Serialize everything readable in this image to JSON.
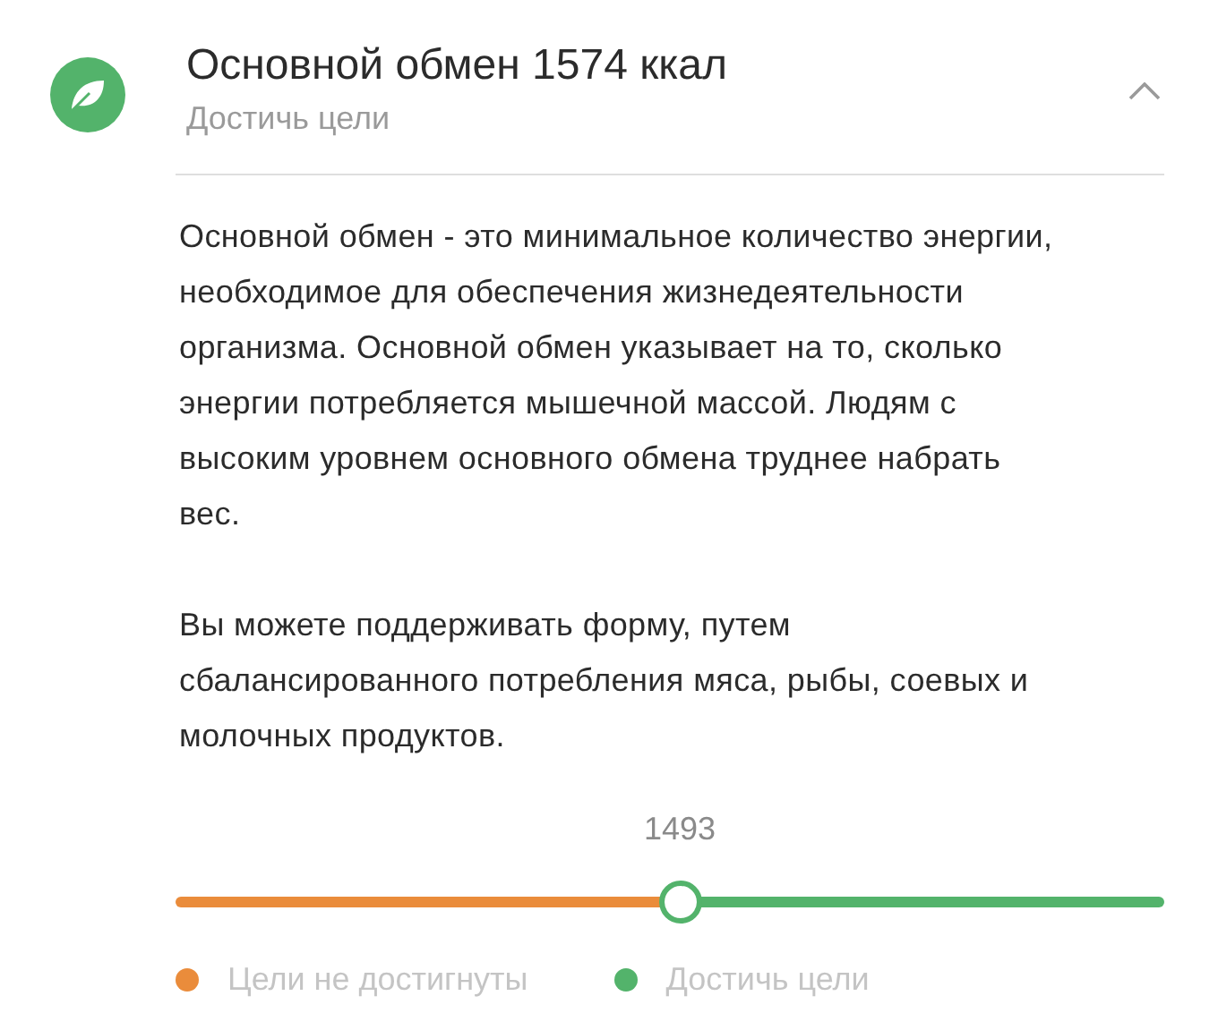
{
  "header": {
    "title": "Основной обмен 1574 ккал",
    "subtitle": "Достичь цели",
    "expanded": true
  },
  "paragraphs": [
    "Основной обмен - это минимальное количество энергии, необходимое для обеспечения жизнедеятельности организма. Основной обмен указывает на то, сколько энергии потребляется мышечной массой. Людям с высоким уровнем основного обмена труднее набрать вес.",
    "Вы можете поддерживать форму, путем сбалансированного потребления мяса, рыбы, соевых и молочных продуктов."
  ],
  "slider": {
    "reading": "1493",
    "level": 0.51
  },
  "legend": [
    {
      "label": "Цели не достигнуты",
      "color": "#ea8c3b"
    },
    {
      "label": "Достичь цели",
      "color": "#53b36b"
    }
  ]
}
